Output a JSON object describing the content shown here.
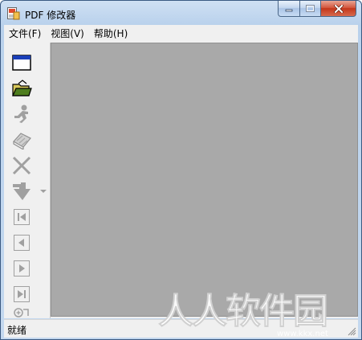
{
  "window": {
    "title": "PDF 修改器"
  },
  "menu": {
    "items": [
      "文件(F)",
      "视图(V)",
      "帮助(H)"
    ]
  },
  "toolbar": {
    "buttons": [
      {
        "icon": "new-window-icon",
        "enabled": true
      },
      {
        "icon": "open-folder-icon",
        "enabled": true
      },
      {
        "icon": "stamp-icon",
        "enabled": false
      },
      {
        "icon": "erase-icon",
        "enabled": false
      },
      {
        "icon": "delete-x-icon",
        "enabled": false
      },
      {
        "icon": "download-arrow-icon",
        "enabled": false,
        "dropdown": true
      },
      {
        "icon": "first-page-icon",
        "enabled": false
      },
      {
        "icon": "previous-page-icon",
        "enabled": false
      },
      {
        "icon": "next-page-icon",
        "enabled": false
      },
      {
        "icon": "last-page-icon",
        "enabled": false
      },
      {
        "icon": "zoom-in-icon",
        "enabled": false
      }
    ]
  },
  "status": {
    "text": "就绪"
  },
  "watermark": {
    "text": "人人软件园",
    "subtext": "www.kkx.net"
  },
  "colors": {
    "canvas_bg": "#a9a9a9",
    "chrome_bg": "#f0f0f0",
    "titlebar": "#c4d8ef",
    "close_button": "#c4361a",
    "disabled_icon": "#a0a0a0"
  }
}
